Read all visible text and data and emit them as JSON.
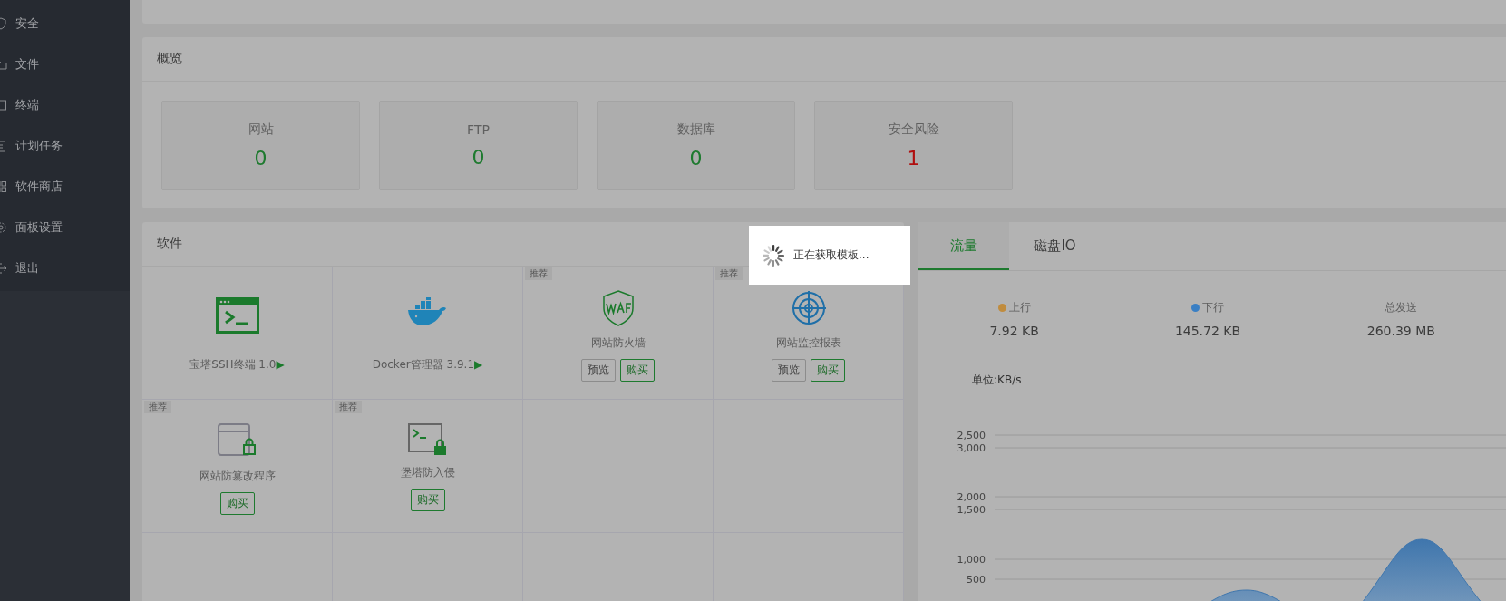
{
  "sidebar": {
    "items": [
      {
        "label": "安全"
      },
      {
        "label": "文件"
      },
      {
        "label": "终端"
      },
      {
        "label": "计划任务"
      },
      {
        "label": "软件商店"
      },
      {
        "label": "面板设置"
      },
      {
        "label": "退出"
      }
    ]
  },
  "overview": {
    "title": "概览",
    "cards": [
      {
        "label": "网站",
        "value": "0",
        "alert": false
      },
      {
        "label": "FTP",
        "value": "0",
        "alert": false
      },
      {
        "label": "数据库",
        "value": "0",
        "alert": false
      },
      {
        "label": "安全风险",
        "value": "1",
        "alert": true
      }
    ]
  },
  "software": {
    "title": "软件",
    "items": [
      {
        "kind": "installed",
        "name": "宝塔SSH终端 1.0",
        "arrow": "▶"
      },
      {
        "kind": "installed",
        "name": "Docker管理器 3.9.1",
        "arrow": "▶"
      },
      {
        "kind": "store",
        "tag": "推荐",
        "name": "网站防火墙",
        "buttons": [
          {
            "label": "预览",
            "kind": "preview"
          },
          {
            "label": "购买",
            "kind": "buy"
          }
        ]
      },
      {
        "kind": "store",
        "tag": "推荐",
        "name": "网站监控报表",
        "buttons": [
          {
            "label": "预览",
            "kind": "preview"
          },
          {
            "label": "购买",
            "kind": "buy"
          }
        ]
      },
      {
        "kind": "store",
        "tag": "推荐",
        "name": "网站防篡改程序",
        "buttons": [
          {
            "label": "购买",
            "kind": "buy"
          }
        ]
      },
      {
        "kind": "store",
        "tag": "推荐",
        "name": "堡塔防入侵",
        "buttons": [
          {
            "label": "购买",
            "kind": "buy"
          }
        ]
      }
    ]
  },
  "traffic": {
    "tabs": [
      {
        "label": "流量",
        "selected": true
      },
      {
        "label": "磁盘IO",
        "selected": false
      }
    ],
    "stats": [
      {
        "label": "上行",
        "value": "7.92 KB",
        "color": "#c08c3e"
      },
      {
        "label": "下行",
        "value": "145.72 KB",
        "color": "#3a7fc4"
      },
      {
        "label": "总发送",
        "value": "260.39 MB"
      }
    ],
    "unit": "单位:KB/s",
    "y_tick_labels": [
      "2,500",
      "3,000",
      "2,000",
      "1,500",
      "1,000",
      "500"
    ]
  },
  "loading": {
    "text": "正在获取模板..."
  }
}
